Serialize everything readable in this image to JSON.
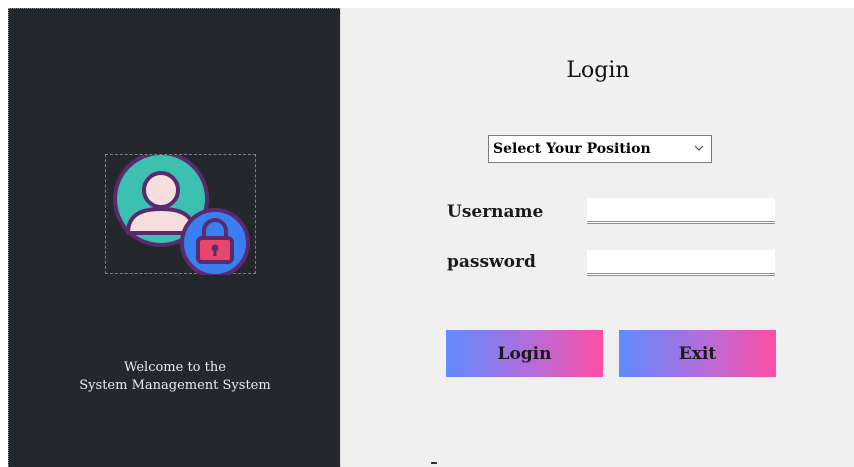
{
  "sidebar": {
    "welcome_line1": "Welcome to the",
    "welcome_line2": "System Management System",
    "logo_icon": "user-lock-icon"
  },
  "login": {
    "title": "Login",
    "position_select": {
      "selected": "Select Your Position"
    },
    "username_label": "Username",
    "username_value": "",
    "password_label": "password",
    "password_value": "",
    "login_button": "Login",
    "exit_button": "Exit"
  },
  "colors": {
    "sidebar_bg": "#24282d",
    "form_bg": "#f0f0f0",
    "button_gradient_start": "#5f8cff",
    "button_gradient_end": "#ff4fa3"
  }
}
